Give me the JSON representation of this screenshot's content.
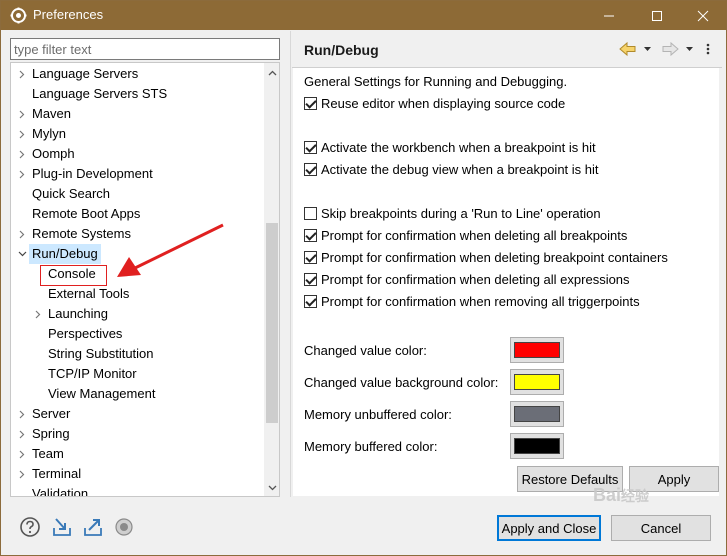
{
  "window": {
    "title": "Preferences"
  },
  "colors": {
    "titlebar": "#8d6a36",
    "selection": "#cce8ff",
    "highlight_box": "#e02020",
    "arrow": "#e02020"
  },
  "filter": {
    "placeholder": "type filter text"
  },
  "tree": {
    "items": [
      {
        "label": "Language Servers",
        "expandable": true,
        "depth": 0
      },
      {
        "label": "Language Servers STS",
        "expandable": false,
        "depth": 0
      },
      {
        "label": "Maven",
        "expandable": true,
        "depth": 0
      },
      {
        "label": "Mylyn",
        "expandable": true,
        "depth": 0
      },
      {
        "label": "Oomph",
        "expandable": true,
        "depth": 0
      },
      {
        "label": "Plug-in Development",
        "expandable": true,
        "depth": 0
      },
      {
        "label": "Quick Search",
        "expandable": false,
        "depth": 0
      },
      {
        "label": "Remote Boot Apps",
        "expandable": false,
        "depth": 0
      },
      {
        "label": "Remote Systems",
        "expandable": true,
        "depth": 0
      },
      {
        "label": "Run/Debug",
        "expandable": true,
        "expanded": true,
        "selected": true,
        "depth": 0
      },
      {
        "label": "Console",
        "expandable": false,
        "depth": 1
      },
      {
        "label": "External Tools",
        "expandable": false,
        "depth": 1
      },
      {
        "label": "Launching",
        "expandable": true,
        "depth": 1
      },
      {
        "label": "Perspectives",
        "expandable": false,
        "depth": 1
      },
      {
        "label": "String Substitution",
        "expandable": false,
        "depth": 1
      },
      {
        "label": "TCP/IP Monitor",
        "expandable": false,
        "depth": 1
      },
      {
        "label": "View Management",
        "expandable": false,
        "depth": 1
      },
      {
        "label": "Server",
        "expandable": true,
        "depth": 0
      },
      {
        "label": "Spring",
        "expandable": true,
        "depth": 0
      },
      {
        "label": "Team",
        "expandable": true,
        "depth": 0
      },
      {
        "label": "Terminal",
        "expandable": true,
        "depth": 0
      },
      {
        "label": "Validation",
        "expandable": false,
        "depth": 0
      }
    ]
  },
  "page": {
    "title": "Run/Debug",
    "description": "General Settings for Running and Debugging.",
    "checkboxes": [
      {
        "label": "Reuse editor when displaying source code",
        "checked": true
      },
      {
        "label": "Activate the workbench when a breakpoint is hit",
        "checked": true
      },
      {
        "label": "Activate the debug view when a breakpoint is hit",
        "checked": true
      },
      {
        "label": "Skip breakpoints during a 'Run to Line' operation",
        "checked": false
      },
      {
        "label": "Prompt for confirmation when deleting all breakpoints",
        "checked": true
      },
      {
        "label": "Prompt for confirmation when deleting breakpoint containers",
        "checked": true
      },
      {
        "label": "Prompt for confirmation when deleting all expressions",
        "checked": true
      },
      {
        "label": "Prompt for confirmation when removing all triggerpoints",
        "checked": true
      }
    ],
    "colors": [
      {
        "label": "Changed value color:",
        "value": "#ff0000"
      },
      {
        "label": "Changed value background color:",
        "value": "#ffff00"
      },
      {
        "label": "Memory unbuffered color:",
        "value": "#6b6e77"
      },
      {
        "label": "Memory buffered color:",
        "value": "#000000"
      }
    ],
    "restore_defaults": "Restore Defaults",
    "apply": "Apply"
  },
  "footer": {
    "apply_and_close": "Apply and Close",
    "cancel": "Cancel"
  },
  "watermark": "Bai 经验"
}
